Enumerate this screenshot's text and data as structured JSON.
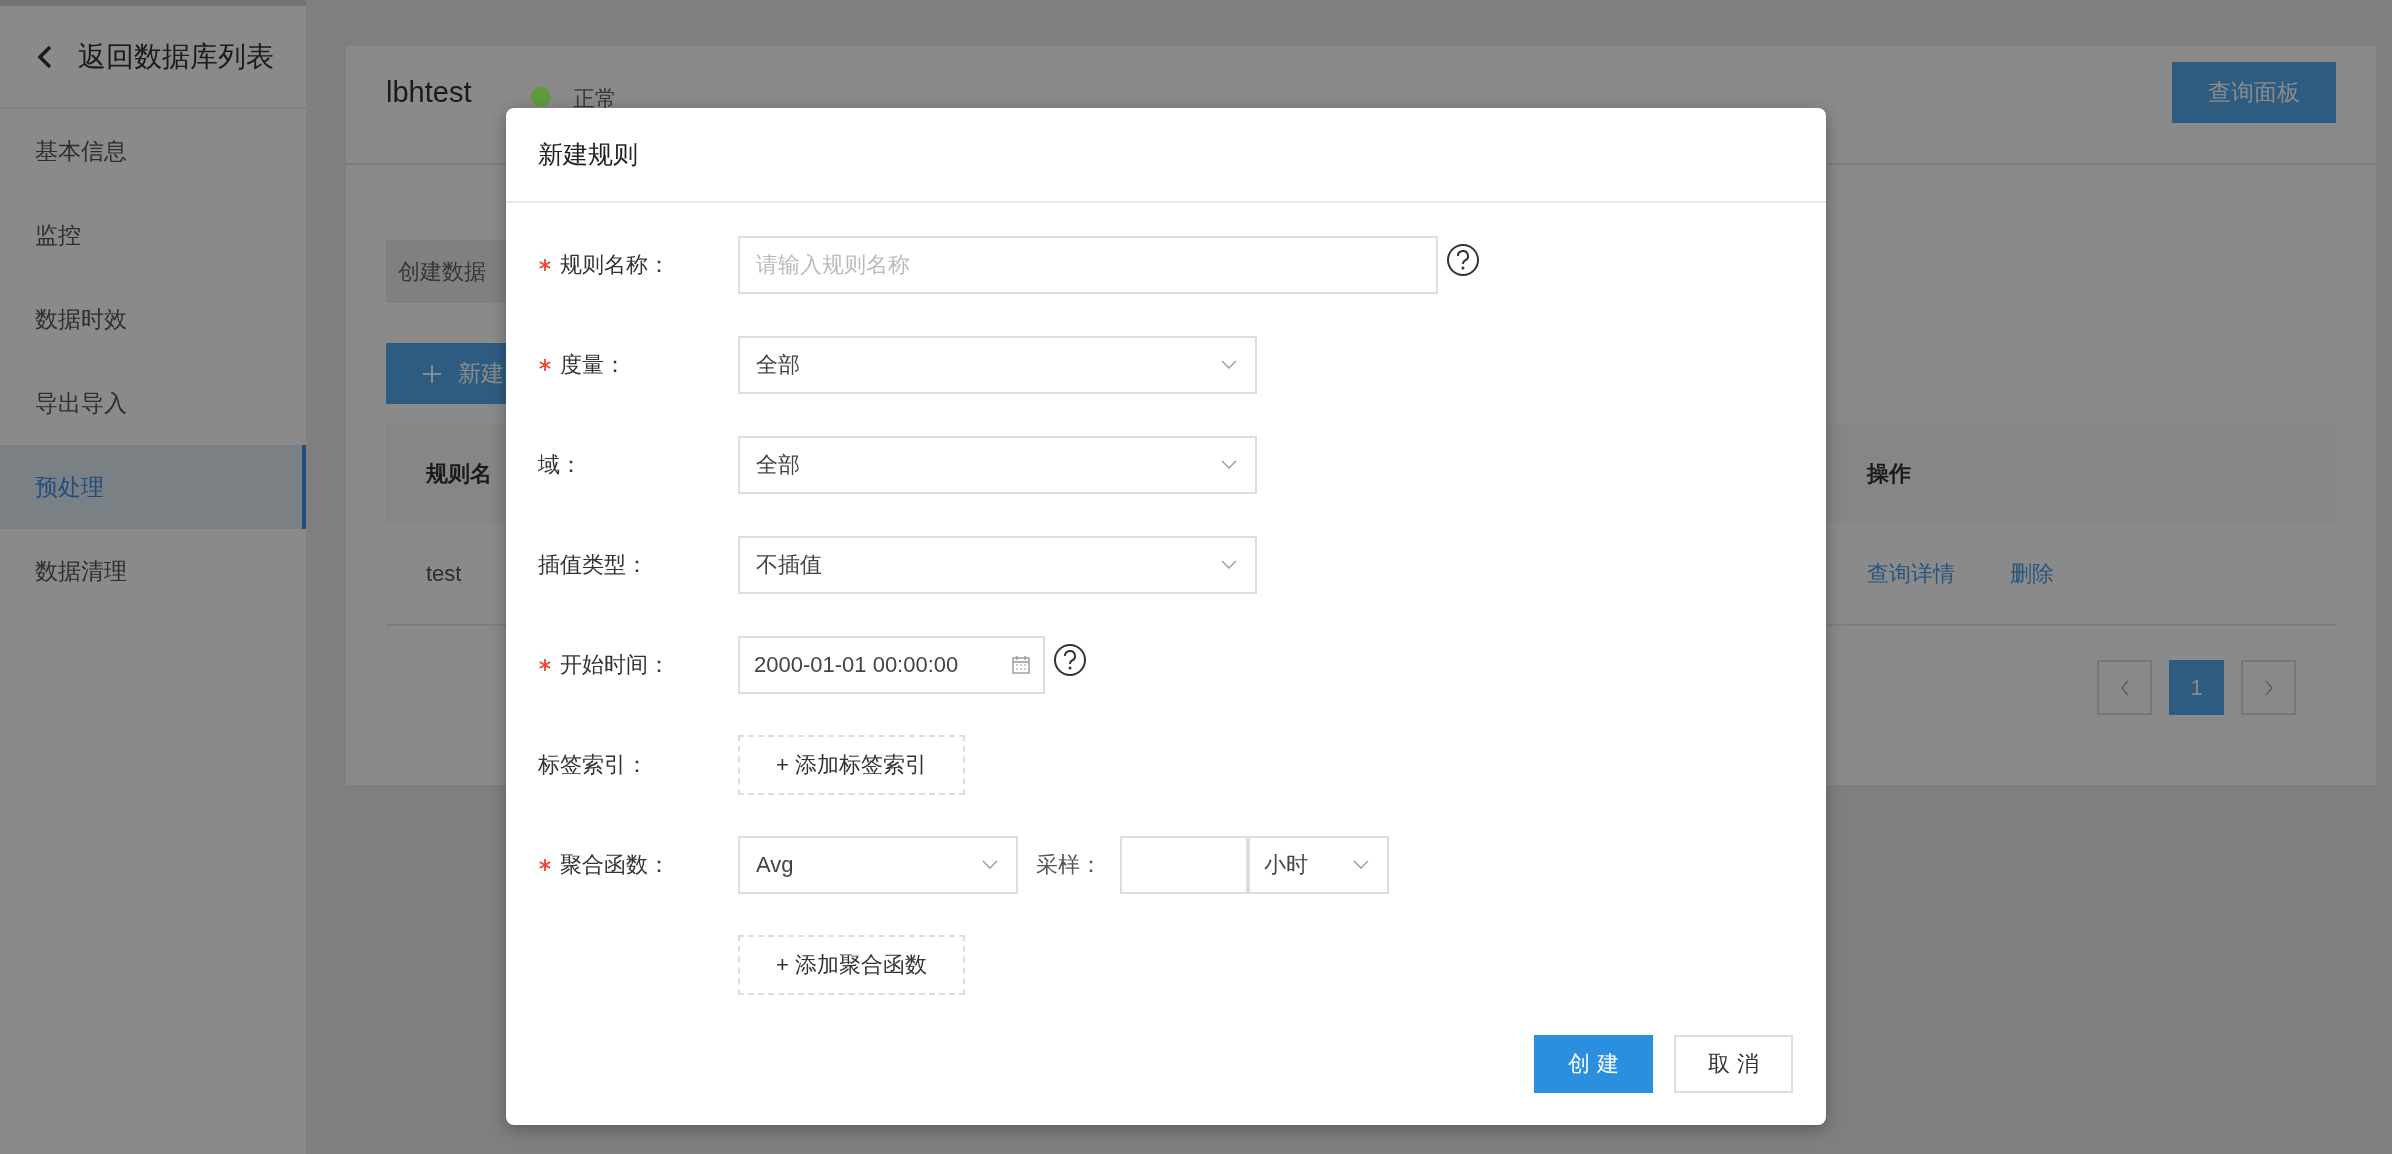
{
  "sidebar": {
    "back_link": "返回数据库列表",
    "items": [
      {
        "label": "基本信息",
        "selected": false
      },
      {
        "label": "监控",
        "selected": false
      },
      {
        "label": "数据时效",
        "selected": false
      },
      {
        "label": "导出导入",
        "selected": false
      },
      {
        "label": "预处理",
        "selected": true
      },
      {
        "label": "数据清理",
        "selected": false
      }
    ]
  },
  "header": {
    "title": "lbhtest",
    "status": {
      "label": "正常",
      "color": "#5f9a3c"
    },
    "button": "查询面板"
  },
  "notice": "创建数据",
  "new_button": "新建",
  "table": {
    "columns": [
      "规则名",
      "操作"
    ],
    "rows": [
      {
        "name": "test",
        "actions": [
          "查询详情",
          "删除"
        ]
      }
    ]
  },
  "pagination": {
    "pages": [
      {
        "label": "1",
        "selected": true
      }
    ]
  },
  "dialog": {
    "title": "新建规则",
    "fields": [
      {
        "kind": "text",
        "label": "规则名称：",
        "required": true,
        "placeholder": "请输入规则名称",
        "help": true
      },
      {
        "kind": "select",
        "label": "度量：",
        "required": true,
        "value": "全部"
      },
      {
        "kind": "select",
        "label": "域：",
        "required": false,
        "value": "全部"
      },
      {
        "kind": "select",
        "label": "插值类型：",
        "required": false,
        "value": "不插值"
      },
      {
        "kind": "date",
        "label": "开始时间：",
        "required": true,
        "value": "2000-01-01 00:00:00",
        "help": true
      },
      {
        "kind": "add",
        "label": "标签索引：",
        "required": false,
        "button": "+ 添加标签索引"
      },
      {
        "kind": "aggregate",
        "label": "聚合函数：",
        "required": true,
        "value": "Avg",
        "sample_label": "采样：",
        "unit": "小时"
      },
      {
        "kind": "add",
        "required": false,
        "button": "+ 添加聚合函数"
      }
    ],
    "buttons": [
      {
        "label": "创 建",
        "primary": true
      },
      {
        "label": "取 消",
        "primary": false
      }
    ]
  }
}
